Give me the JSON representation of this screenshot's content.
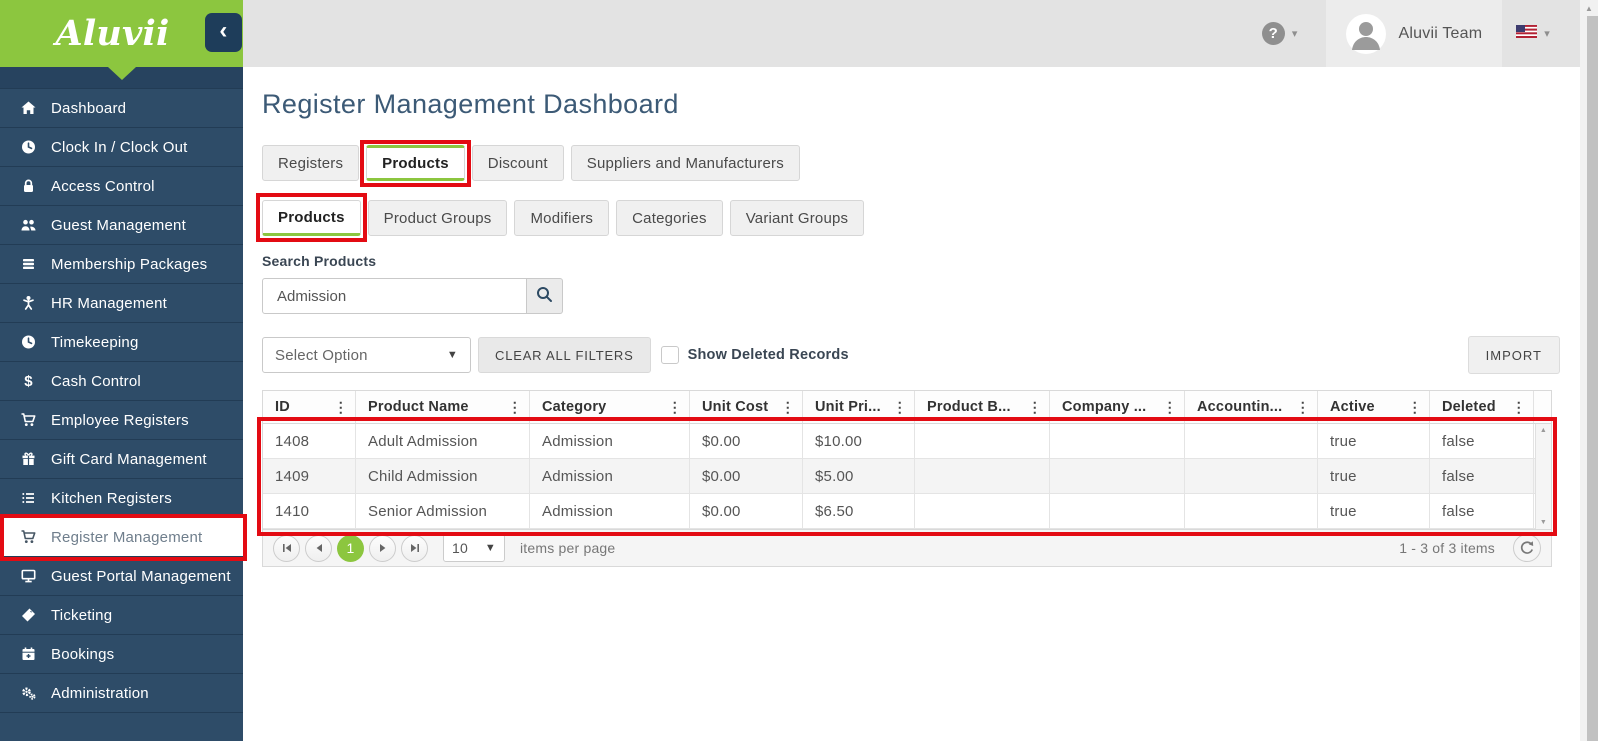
{
  "colors": {
    "accent_green": "#8CC63F",
    "sidebar_navy": "#2E4C68",
    "annotation_red": "#E30B13"
  },
  "brand": {
    "logo_text": "Aluvii",
    "collapse_glyph": "‹"
  },
  "topbar": {
    "help_glyph": "?",
    "user_name": "Aluvii Team"
  },
  "sidebar": {
    "items": [
      {
        "label": "Dashboard",
        "icon": "home-icon"
      },
      {
        "label": "Clock In / Clock Out",
        "icon": "clock-icon"
      },
      {
        "label": "Access Control",
        "icon": "lock-icon"
      },
      {
        "label": "Guest Management",
        "icon": "users-icon"
      },
      {
        "label": "Membership Packages",
        "icon": "stack-icon"
      },
      {
        "label": "HR Management",
        "icon": "person-icon"
      },
      {
        "label": "Timekeeping",
        "icon": "clock-icon"
      },
      {
        "label": "Cash Control",
        "icon": "dollar-icon"
      },
      {
        "label": "Employee Registers",
        "icon": "cart-icon"
      },
      {
        "label": "Gift Card Management",
        "icon": "gift-icon"
      },
      {
        "label": "Kitchen Registers",
        "icon": "checklist-icon"
      },
      {
        "label": "Register Management",
        "icon": "cart-icon",
        "active": true,
        "annotated": true
      },
      {
        "label": "Guest Portal Management",
        "icon": "monitor-icon"
      },
      {
        "label": "Ticketing",
        "icon": "ticket-icon"
      },
      {
        "label": "Bookings",
        "icon": "calendar-icon"
      },
      {
        "label": "Administration",
        "icon": "gears-icon"
      }
    ]
  },
  "page": {
    "title": "Register Management Dashboard"
  },
  "tabs": {
    "main": [
      {
        "label": "Registers"
      },
      {
        "label": "Products",
        "active": true,
        "annotated": true
      },
      {
        "label": "Discount"
      },
      {
        "label": "Suppliers and Manufacturers"
      }
    ],
    "sub": [
      {
        "label": "Products",
        "active": true,
        "annotated": true
      },
      {
        "label": "Product Groups"
      },
      {
        "label": "Modifiers"
      },
      {
        "label": "Categories"
      },
      {
        "label": "Variant Groups"
      }
    ]
  },
  "search": {
    "label": "Search Products",
    "value": "Admission"
  },
  "filters": {
    "select_value": "Select Option",
    "clear_button": "CLEAR ALL FILTERS",
    "show_deleted_label": "Show Deleted Records",
    "show_deleted_checked": false,
    "import_button": "IMPORT"
  },
  "table": {
    "annotated": true,
    "columns": [
      "ID",
      "Product Name",
      "Category",
      "Unit Cost",
      "Unit Pri...",
      "Product B...",
      "Company ...",
      "Accountin...",
      "Active",
      "Deleted"
    ],
    "rows": [
      [
        "1408",
        "Adult Admission",
        "Admission",
        "$0.00",
        "$10.00",
        "",
        "",
        "",
        "true",
        "false"
      ],
      [
        "1409",
        "Child Admission",
        "Admission",
        "$0.00",
        "$5.00",
        "",
        "",
        "",
        "true",
        "false"
      ],
      [
        "1410",
        "Senior Admission",
        "Admission",
        "$0.00",
        "$6.50",
        "",
        "",
        "",
        "true",
        "false"
      ]
    ]
  },
  "pager": {
    "current_page": "1",
    "page_size": "10",
    "items_per_page_label": "items per page",
    "range_label": "1 - 3 of 3 items"
  }
}
